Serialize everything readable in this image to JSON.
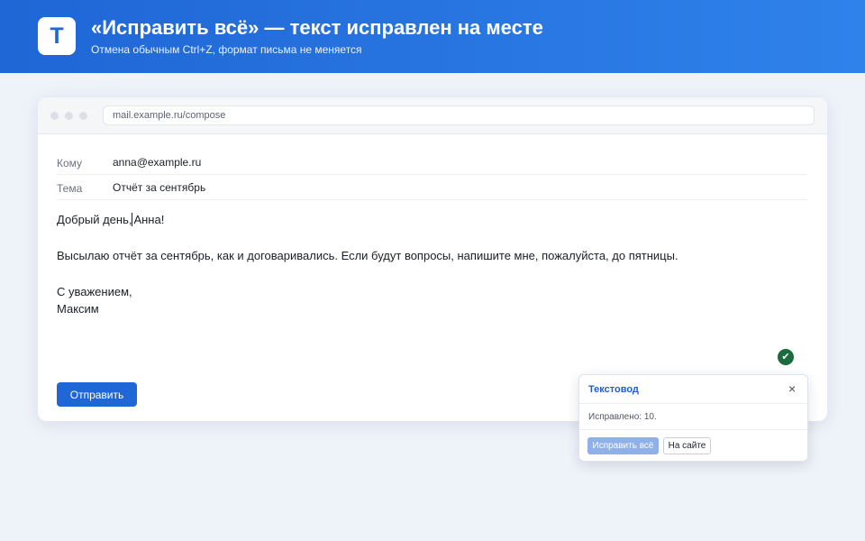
{
  "banner": {
    "logo_letter": "T",
    "title": "«Исправить всё» — текст исправлен на месте",
    "subtitle": "Отмена обычным Ctrl+Z, формат письма не меняется"
  },
  "browser": {
    "url": "mail.example.ru/compose"
  },
  "compose": {
    "to_label": "Кому",
    "to_value": "anna@example.ru",
    "subject_label": "Тема",
    "subject_value": "Отчёт за сентябрь",
    "greeting_before_caret": "Добрый день,",
    "greeting_after_caret": "Анна!",
    "paragraph": "Высылаю отчёт за сентябрь, как и договаривались. Если будут вопросы, напишите мне, пожалуйста, до пятницы.",
    "closing": "С уважением,",
    "signature": "Максим",
    "send_label": "Отправить"
  },
  "status_badge": {
    "icon": "checkmark-icon",
    "glyph": "✔",
    "color": "#1b6b3d"
  },
  "popup": {
    "title": "Текстовод",
    "close_glyph": "×",
    "status": "Исправлено: 10.",
    "fix_all_label": "Исправить всё",
    "on_site_label": "На сайте"
  },
  "colors": {
    "accent": "#1f66d6",
    "background": "#eef2f9"
  }
}
